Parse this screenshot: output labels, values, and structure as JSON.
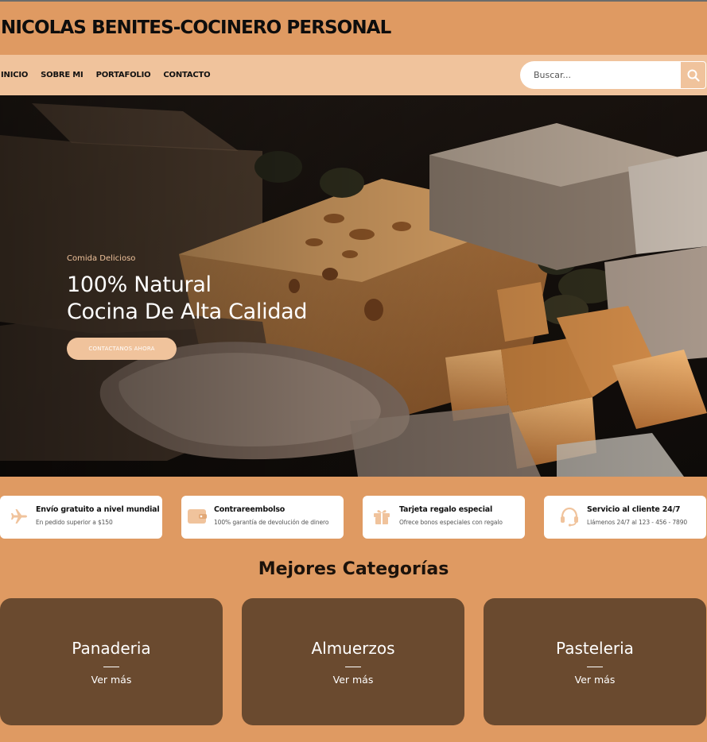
{
  "header": {
    "title": "NICOLAS BENITES-COCINERO PERSONAL"
  },
  "nav": {
    "items": [
      "INICIO",
      "SOBRE MI",
      "PORTAFOLIO",
      "CONTACTO"
    ]
  },
  "search": {
    "placeholder": "Buscar...",
    "icon": "search-icon"
  },
  "hero": {
    "eyebrow": "Comida Delicioso",
    "title_line1": "100% Natural",
    "title_line2": "Cocina De Alta Calidad",
    "button": "CONTACTANOS AHORA"
  },
  "features": [
    {
      "icon": "airplane-icon",
      "title": "Envío gratuito a nivel mundial",
      "subtitle": "En pedido superior a $150"
    },
    {
      "icon": "wallet-icon",
      "title": "Contrareembolso",
      "subtitle": "100% garantía de devolución de dinero"
    },
    {
      "icon": "gift-icon",
      "title": "Tarjeta regalo especial",
      "subtitle": "Ofrece bonos especiales con regalo"
    },
    {
      "icon": "headset-icon",
      "title": "Servicio al cliente 24/7",
      "subtitle": "Llámenos 24/7 al 123 - 456 - 7890"
    }
  ],
  "categories": {
    "heading": "Mejores Categorías",
    "items": [
      {
        "name": "Panaderia",
        "link": "Ver más"
      },
      {
        "name": "Almuerzos",
        "link": "Ver más"
      },
      {
        "name": "Pasteleria",
        "link": "Ver más"
      }
    ]
  },
  "colors": {
    "page": "#DF9A62",
    "nav": "#F0C39C",
    "card": "#6A4A2F",
    "accent": "#F0C39C"
  }
}
